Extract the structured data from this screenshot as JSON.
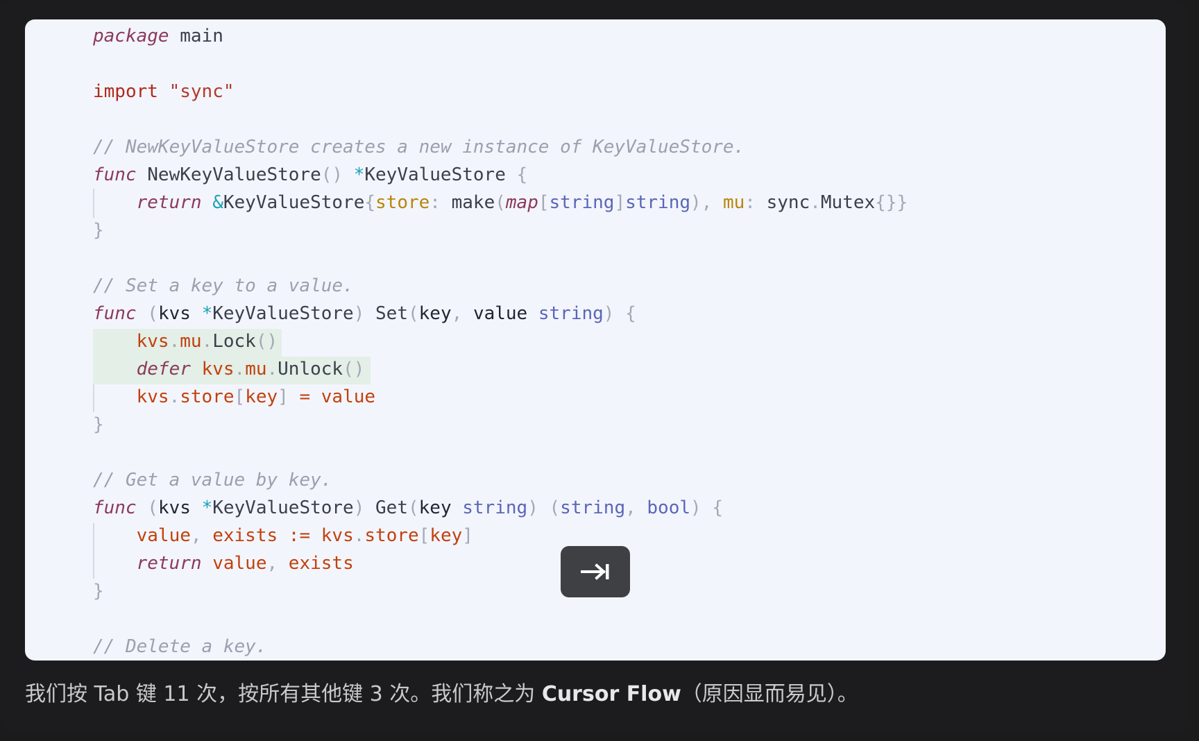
{
  "code": {
    "l1_kw": "package",
    "l1_name": " main",
    "l2_kw": "import",
    "l2_str": " \"sync\"",
    "c1": "// NewKeyValueStore creates a new instance of KeyValueStore.",
    "c2": "// Set a key to a value.",
    "c3": "// Get a value by key.",
    "c4": "// Delete a key."
  },
  "tab_key": {
    "icon": "tab-arrow-icon"
  },
  "caption": {
    "prefix": "我们按 Tab 键 11 次，按所有其他键 3 次。我们称之为 ",
    "bold": "Cursor Flow",
    "suffix": "（原因显而易见）。"
  },
  "colors": {
    "editor_bg": "#f3f5fd",
    "frame_bg": "#1c1c1e",
    "highlight": "#e3efe7"
  }
}
